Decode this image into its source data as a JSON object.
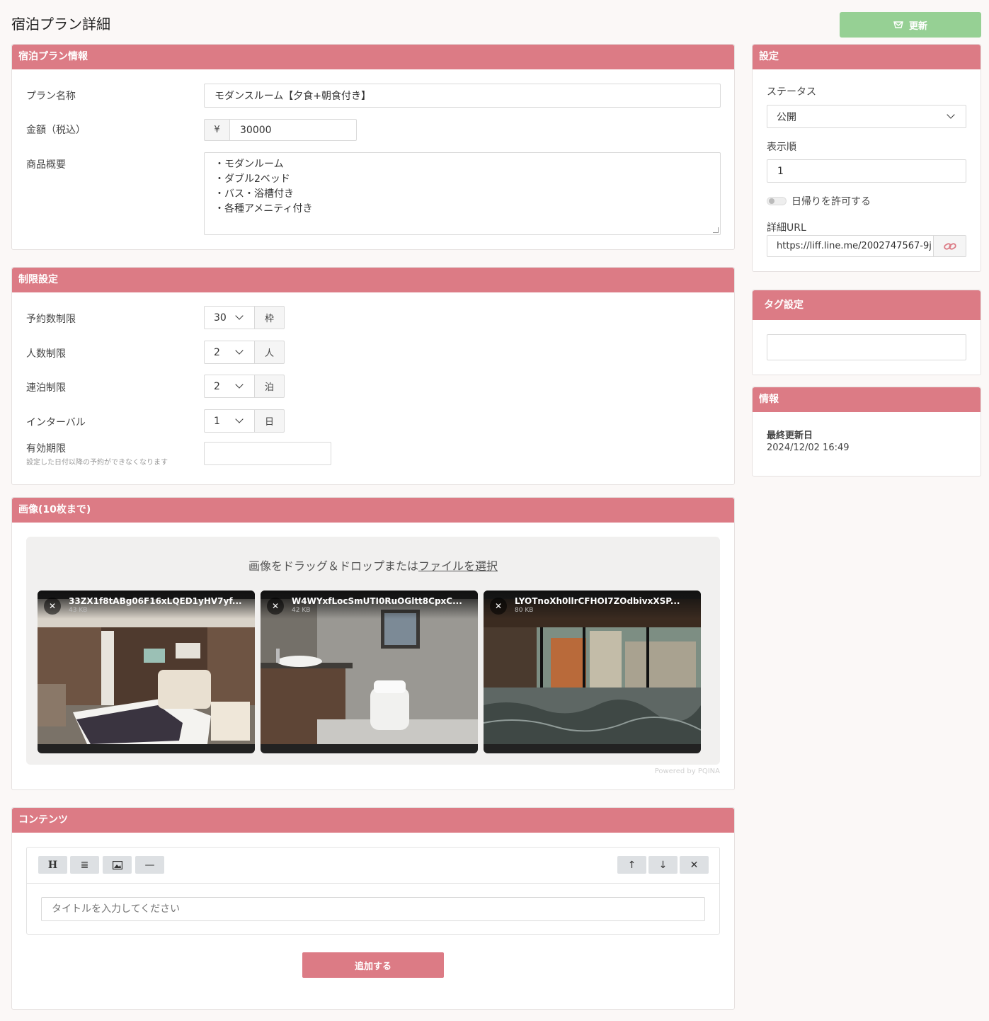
{
  "page": {
    "title": "宿泊プラン詳細",
    "update_label": "更新"
  },
  "plan_info": {
    "header": "宿泊プラン情報",
    "name_label": "プラン名称",
    "name_value": "モダンスルーム【夕食+朝食付き】",
    "price_label": "金額（税込）",
    "currency": "¥",
    "price_value": "30000",
    "summary_label": "商品概要",
    "summary_lines": [
      "・モダンルーム",
      "・ダブル2ベッド",
      "・バス・浴槽付き",
      "・各種アメニティ付き"
    ]
  },
  "limits": {
    "header": "制限設定",
    "rows": [
      {
        "label": "予約数制限",
        "value": "30",
        "unit": "枠"
      },
      {
        "label": "人数制限",
        "value": "2",
        "unit": "人"
      },
      {
        "label": "連泊制限",
        "value": "2",
        "unit": "泊"
      },
      {
        "label": "インターバル",
        "value": "1",
        "unit": "日"
      }
    ],
    "expiry_label": "有効期限",
    "expiry_note": "設定した日付以降の予約ができなくなります",
    "expiry_value": ""
  },
  "images": {
    "header": "画像(10枚まで)",
    "drop_text": "画像をドラッグ＆ドロップまたは",
    "drop_link": "ファイルを選択",
    "powered": "Powered by PQINA",
    "files": [
      {
        "name": "33ZX1f8tABg06F16xLQED1yHV7yf...",
        "size": "43 KB"
      },
      {
        "name": "W4WYxfLocSmUTI0RuOGltt8CpxC...",
        "size": "42 KB"
      },
      {
        "name": "LYOTnoXh0llrCFHOI7ZOdbivxXSP...",
        "size": "80 KB"
      }
    ]
  },
  "content": {
    "header": "コンテンツ",
    "title_placeholder": "タイトルを入力してください",
    "add_label": "追加する",
    "tools": {
      "heading": "H",
      "list": "≣",
      "image": "image-icon",
      "divider": "—",
      "up": "↑",
      "down": "↓",
      "remove": "✕"
    }
  },
  "settings": {
    "header": "設定",
    "status_label": "ステータス",
    "status_value": "公開",
    "order_label": "表示順",
    "order_value": "1",
    "daytrip_label": "日帰りを許可する",
    "url_label": "詳細URL",
    "url_value": "https://liff.line.me/2002747567-9j"
  },
  "tags": {
    "header": "タグ設定"
  },
  "info": {
    "header": "情報",
    "updated_label": "最終更新日",
    "updated_value": "2024/12/02 16:49"
  },
  "colors": {
    "accent": "#dc7b85",
    "update_button": "#96d094",
    "background": "#fbf8f7"
  }
}
